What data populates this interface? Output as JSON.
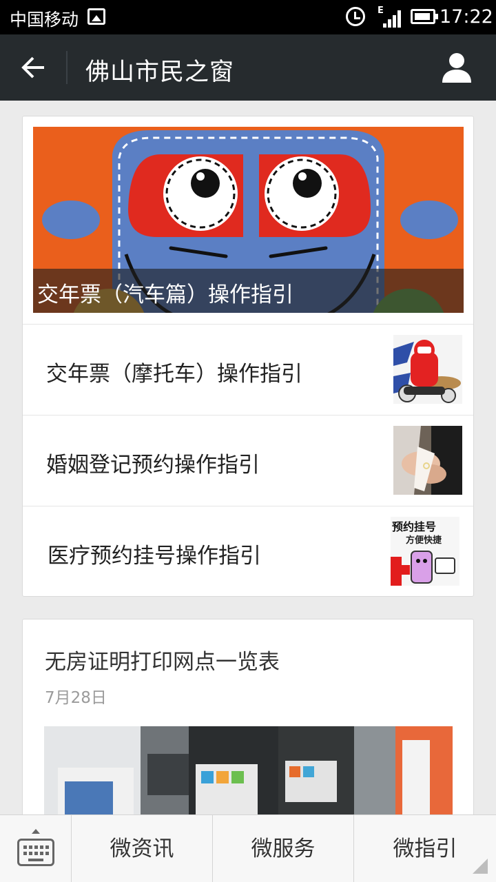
{
  "status_bar": {
    "carrier": "中国移动",
    "network": "E",
    "time": "17:22",
    "icons": [
      "image-notification-icon",
      "alarm-icon",
      "signal-icon",
      "battery-icon"
    ]
  },
  "header": {
    "title": "佛山市民之窗",
    "icons": [
      "back-arrow-icon",
      "profile-icon"
    ],
    "background": "#262b2e"
  },
  "feed": {
    "featured": {
      "title": "交年票（汽车篇）操作指引",
      "image": "car-cartoon-illustration"
    },
    "items": [
      {
        "title": "交年票（摩托车）操作指引",
        "thumb": "motorcycle-cartoon-thumb"
      },
      {
        "title": "婚姻登记预约操作指引",
        "thumb": "wedding-rings-photo-thumb"
      },
      {
        "title": "医疗预约挂号操作指引",
        "thumb": "appointment-cartoon-thumb",
        "thumb_text_1": "预约挂号",
        "thumb_text_2": "方便快捷"
      }
    ]
  },
  "article": {
    "title": "无房证明打印网点一览表",
    "date": "7月28日",
    "image": "self-service-kiosks-photo"
  },
  "bottom_nav": {
    "keyboard_icon": "keyboard-icon",
    "tabs": [
      {
        "label": "微资讯"
      },
      {
        "label": "微服务"
      },
      {
        "label": "微指引"
      }
    ]
  },
  "colors": {
    "page_background": "#ebebeb",
    "hero_orange": "#ea5f1c",
    "car_blue": "#5b7fc4",
    "eye_red": "#e02a1f"
  }
}
